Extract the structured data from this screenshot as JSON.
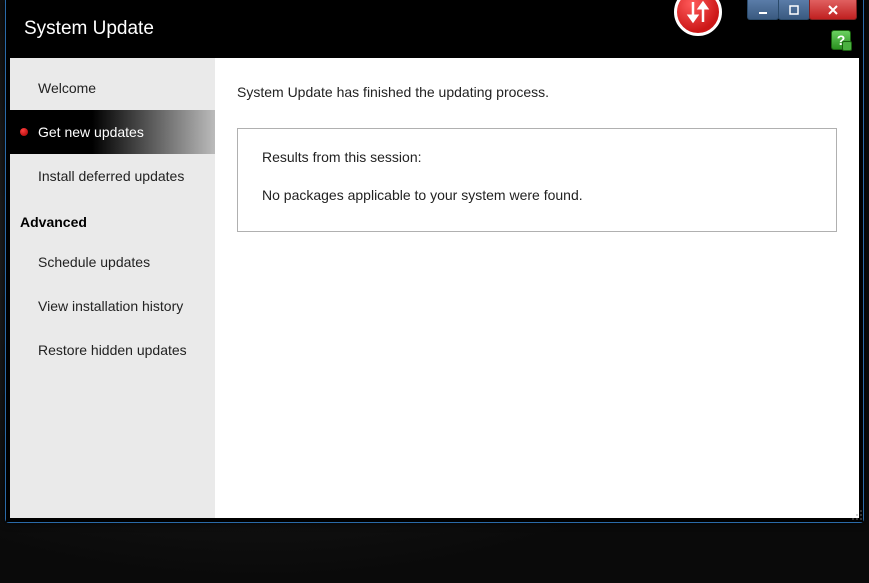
{
  "header": {
    "title": "System Update"
  },
  "sidebar": {
    "items": [
      {
        "label": "Welcome"
      },
      {
        "label": "Get new updates"
      },
      {
        "label": "Install deferred updates"
      }
    ],
    "section_heading": "Advanced",
    "advanced_items": [
      {
        "label": "Schedule updates"
      },
      {
        "label": "View installation history"
      },
      {
        "label": "Restore hidden updates"
      }
    ]
  },
  "main": {
    "status_message": "System Update has finished the updating process.",
    "results_title": "Results from this session:",
    "results_body": "No packages applicable to your system were found."
  },
  "icons": {
    "help": "?",
    "badge": "update-arrows-icon"
  }
}
